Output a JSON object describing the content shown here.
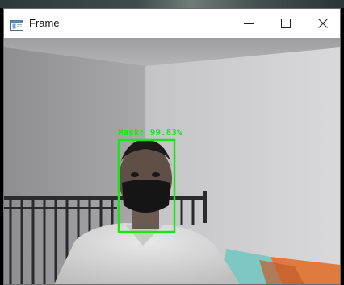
{
  "window": {
    "title": "Frame",
    "icons": {
      "app": "frame-window-icon",
      "minimize": "minimize-icon",
      "maximize": "maximize-icon",
      "close": "close-icon"
    }
  },
  "detection": {
    "label": "Mask: 99.83%",
    "box_color": "#19e619"
  }
}
